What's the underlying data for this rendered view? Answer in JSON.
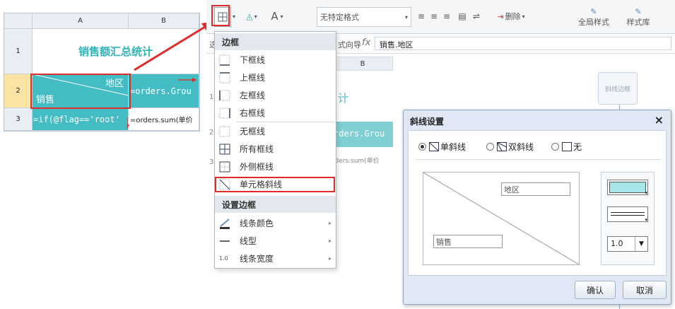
{
  "sheet": {
    "columns": [
      "A",
      "B"
    ],
    "rows": [
      "1",
      "2",
      "3"
    ],
    "title_cell": "销售额汇总统计",
    "diag_top_label": "地区",
    "diag_bottom_label": "销售",
    "b2_text": "=orders.Grou",
    "a3_text": "=if(@flag=='root'",
    "b3_text": "=orders.sum(单价"
  },
  "toolbar": {
    "style_select": "无特定格式",
    "delete_label": "删除",
    "global_style": "全局样式",
    "style_lib": "样式库",
    "font_label": "A"
  },
  "formulabar": {
    "wizard_label": "式向导",
    "fx": "fx",
    "value": "销售.地区",
    "left_clip": "选"
  },
  "bg_sheet": {
    "col_b": "B",
    "cell_title": "计",
    "cell_b2": "rders.Grou",
    "cell_b3": "rders.sum(单价",
    "rows": [
      "1",
      "2",
      "3"
    ],
    "float_label": "斜线边框"
  },
  "menu": {
    "section_border": "边框",
    "items": [
      {
        "label": "下框线",
        "icon": "bottom-border-icon"
      },
      {
        "label": "上框线",
        "icon": "top-border-icon"
      },
      {
        "label": "左框线",
        "icon": "left-border-icon"
      },
      {
        "label": "右框线",
        "icon": "right-border-icon"
      },
      {
        "label": "无框线",
        "icon": "no-border-icon"
      },
      {
        "label": "所有框线",
        "icon": "all-borders-icon"
      },
      {
        "label": "外侧框线",
        "icon": "outside-borders-icon"
      },
      {
        "label": "单元格斜线",
        "icon": "cell-diagonal-icon"
      }
    ],
    "section_set": "设置边框",
    "sub_items": [
      {
        "label": "线条颜色",
        "icon": "line-color-icon"
      },
      {
        "label": "线型",
        "icon": "line-style-icon"
      },
      {
        "label": "线条宽度",
        "icon": "line-width-icon",
        "icon_text": "1.0"
      }
    ]
  },
  "dialog": {
    "title": "斜线设置",
    "close": "×",
    "radio_single": "单斜线",
    "radio_double": "双斜线",
    "radio_none": "无",
    "selected": "single",
    "preview_top": "地区",
    "preview_bottom": "销售",
    "line_color": "#a6e6e8",
    "width_value": "1.0",
    "ok": "确认",
    "cancel": "取消"
  },
  "colors": {
    "teal": "#43bcc3",
    "title_teal": "#2fb3b8",
    "highlight_red": "#e02b2b"
  }
}
